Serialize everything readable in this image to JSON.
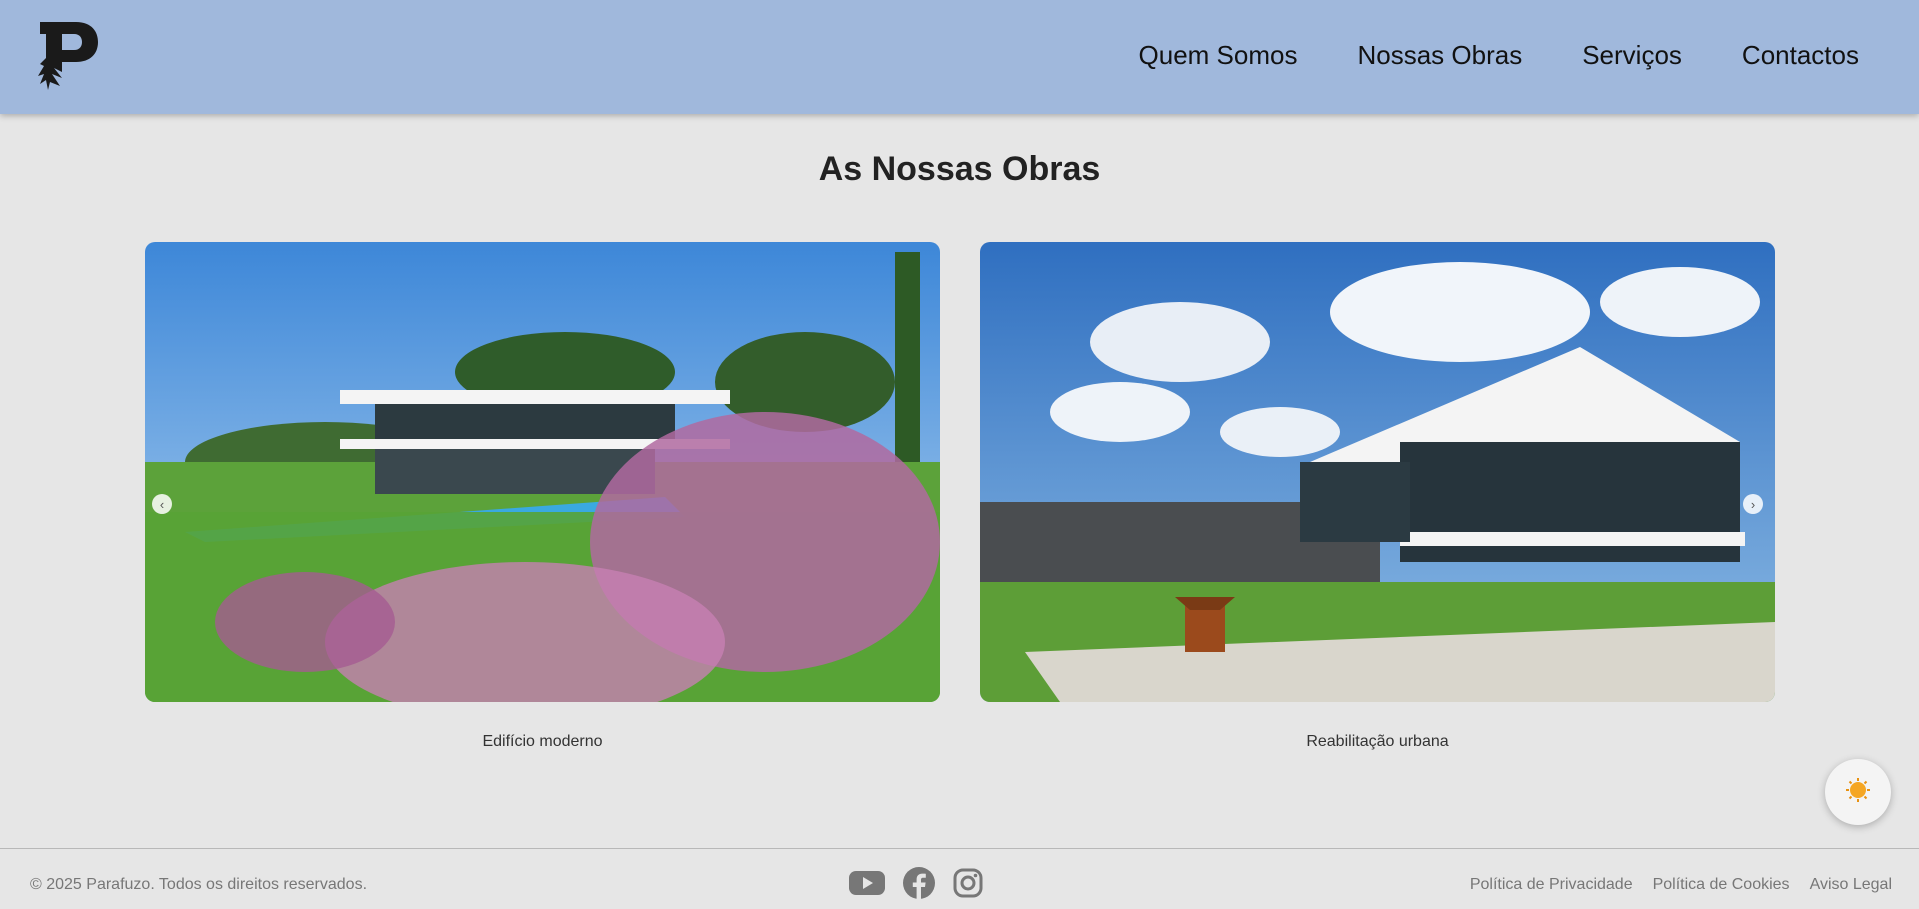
{
  "header": {
    "nav": [
      "Quem Somos",
      "Nossas Obras",
      "Serviços",
      "Contactos"
    ]
  },
  "main": {
    "title": "As Nossas Obras",
    "projects": [
      {
        "caption": "Edifício moderno"
      },
      {
        "caption": "Reabilitação urbana"
      }
    ]
  },
  "footer": {
    "copyright": "© 2025 Parafuzo. Todos os direitos reservados.",
    "social": [
      "youtube-icon",
      "facebook-icon",
      "instagram-icon"
    ],
    "legal_links": [
      "Política de Privacidade",
      "Política de Cookies",
      "Aviso Legal"
    ]
  },
  "colors": {
    "header_bg": "#a0b8dc",
    "page_bg": "#e6e6e6",
    "accent_sun": "#f5a623"
  }
}
